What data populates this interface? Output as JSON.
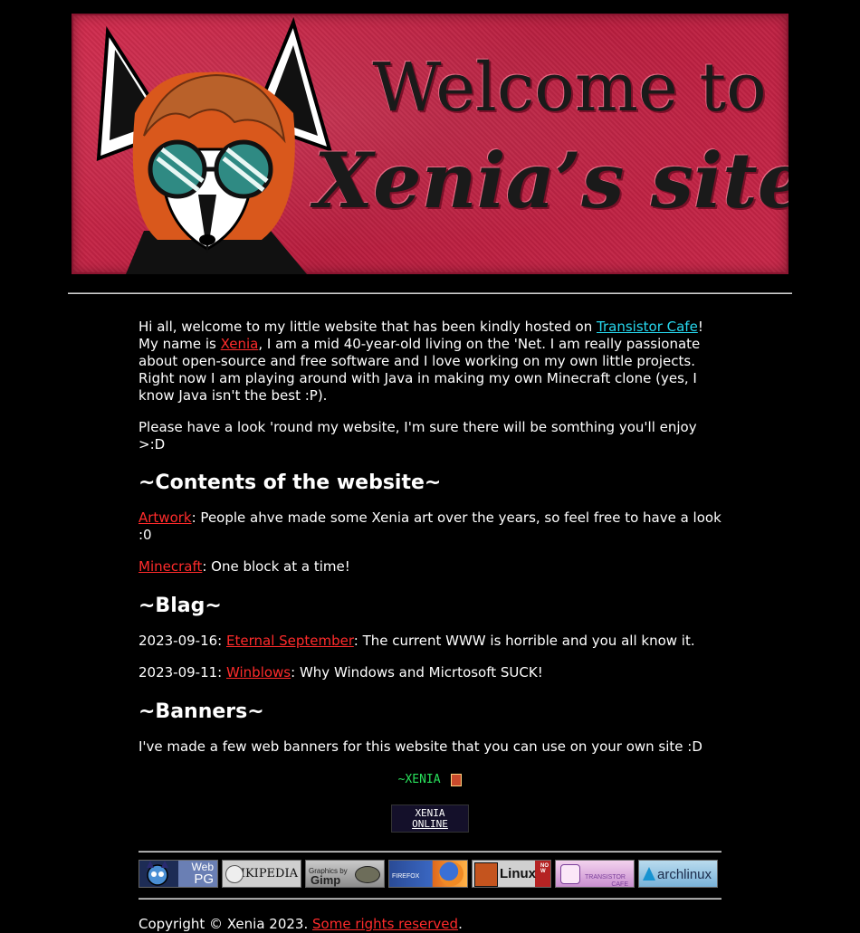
{
  "header": {
    "line1": "Welcome to",
    "line2": "Xenia’s site!"
  },
  "intro": {
    "part1": "Hi all, welcome to my little website that has been kindly hosted on ",
    "host_link": "Transistor Cafe",
    "part2": "! My name is ",
    "name_link": "Xenia",
    "part3": ", I am a mid 40-year-old living on the 'Net. I am really passionate about open-source and free software and I love working on my own little projects. Right now I am playing around with Java in making my own Minecraft clone (yes, I know Java isn't the best :P).",
    "second": "Please have a look 'round my website, I'm sure there will be somthing you'll enjoy >:D"
  },
  "contents": {
    "heading": "~Contents of the website~",
    "items": [
      {
        "link": "Artwork",
        "text": ": People ahve made some Xenia art over the years, so feel free to have a look :0"
      },
      {
        "link": "Minecraft",
        "text": ": One block at a time!"
      }
    ]
  },
  "blag": {
    "heading": "~Blag~",
    "posts": [
      {
        "date": "2023-09-16: ",
        "link": "Eternal September",
        "text": ": The current WWW is horrible and you all know it."
      },
      {
        "date": "2023-09-11: ",
        "link": "Winblows",
        "text": ": Why Windows and Micrtosoft SUCK!"
      }
    ]
  },
  "banners": {
    "heading": "~Banners~",
    "text": "I've made a few web banners for this website that you can use on your own site :D",
    "banner1_text": "~XENIA",
    "banner2_line1": "XENIA",
    "banner2_line2": "ONLINE"
  },
  "buttons": {
    "webpg": {
      "line1": "Web",
      "line2": "PG"
    },
    "wikipedia": "WIKIPEDIA",
    "gimp": {
      "line1": "Graphics by",
      "line2": "Gimp"
    },
    "firefox": "FIREFOX",
    "linux": "Linux",
    "linux_side": "NOW",
    "transistor": {
      "line1": "TRANSISTOR",
      "line2": "CAFE"
    },
    "arch": "archlinux"
  },
  "footer": {
    "copyright": "Copyright © Xenia 2023. ",
    "rights_link": "Some rights reserved",
    "period": "."
  },
  "colors": {
    "background": "#000000",
    "link_red": "#ff2b2b",
    "link_cyan": "#27d8ef",
    "banner_red": "#c72648"
  }
}
